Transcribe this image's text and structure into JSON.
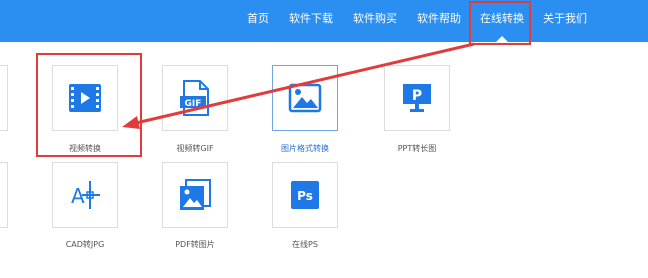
{
  "nav": {
    "items": [
      {
        "label": "首页"
      },
      {
        "label": "软件下载"
      },
      {
        "label": "软件购买"
      },
      {
        "label": "软件帮助"
      },
      {
        "label": "在线转换"
      },
      {
        "label": "关于我们"
      }
    ]
  },
  "tiles": {
    "row1": [
      {
        "label": "视频转换",
        "icon": "video-icon"
      },
      {
        "label": "视频转GIF",
        "icon": "gif-file-icon"
      },
      {
        "label": "图片格式转换",
        "icon": "image-icon",
        "selected": true
      },
      {
        "label": "PPT转长图",
        "icon": "ppt-icon"
      }
    ],
    "row2": [
      {
        "label": "CAD转JPG",
        "icon": "cad-icon"
      },
      {
        "label": "PDF转图片",
        "icon": "pdf-image-icon"
      },
      {
        "label": "在线PS",
        "icon": "ps-icon"
      }
    ]
  },
  "colors": {
    "nav_bg": "#2b8ef1",
    "icon_blue": "#1e78e6",
    "highlight_red": "#e23b3b"
  }
}
